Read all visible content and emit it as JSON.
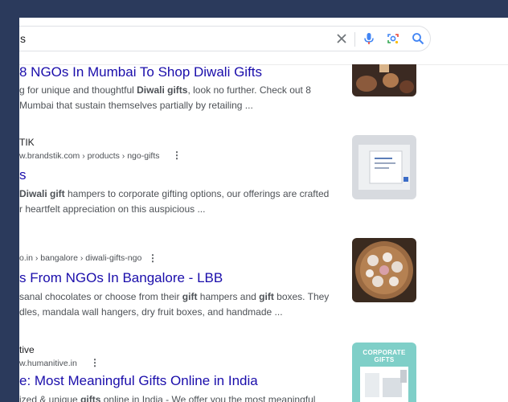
{
  "search": {
    "query": "s",
    "clear_icon": "close-icon",
    "mic_icon": "microphone-icon",
    "lens_icon": "camera-lens-icon",
    "search_icon": "search-icon"
  },
  "results": [
    {
      "title": "8 NGOs In Mumbai To Shop Diwali Gifts",
      "snippet": [
        {
          "text": "g for unique and thoughtful ",
          "bold": false
        },
        {
          "text": "Diwali gifts",
          "bold": true
        },
        {
          "text": ", look no further. Check out 8",
          "bold": false
        },
        {
          "text": "\nMumbai that sustain themselves partially by retailing ...",
          "bold": false
        }
      ]
    },
    {
      "site": "TIK",
      "url": "w.brandstik.com › products › ngo-gifts",
      "title": "s",
      "snippet": [
        {
          "text": "Diwali gift",
          "bold": true
        },
        {
          "text": " hampers to corporate gifting options, our offerings are crafted",
          "bold": false
        },
        {
          "text": "\nr heartfelt appreciation on this auspicious ...",
          "bold": false
        }
      ]
    },
    {
      "url": "o.in › bangalore › diwali-gifts-ngo",
      "title": "s From NGOs In Bangalore - LBB",
      "snippet": [
        {
          "text": "sanal chocolates or choose from their ",
          "bold": false
        },
        {
          "text": "gift",
          "bold": true
        },
        {
          "text": " hampers and ",
          "bold": false
        },
        {
          "text": "gift",
          "bold": true
        },
        {
          "text": " boxes. They",
          "bold": false
        },
        {
          "text": "\ndles, mandala wall hangers, dry fruit boxes, and handmade ...",
          "bold": false
        }
      ]
    },
    {
      "site": "tive",
      "url": "w.humanitive.in",
      "title": "e: Most Meaningful Gifts Online in India",
      "snippet": [
        {
          "text": "ized & unique ",
          "bold": false
        },
        {
          "text": "gifts",
          "bold": true
        },
        {
          "text": " online in India - We offer you the most meaningful",
          "bold": false
        }
      ],
      "thumb_caption": "CORPORATE GIFTS"
    }
  ],
  "colors": {
    "link": "#1a0dab",
    "snippet": "#4d5156",
    "background": "#2b3a5c"
  }
}
